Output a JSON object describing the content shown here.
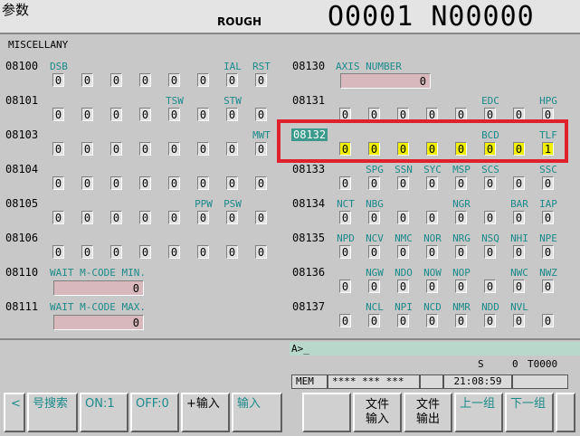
{
  "header": {
    "title_zh": "参数",
    "mode": "ROUGH",
    "program": "O0001 N00000"
  },
  "section": "MISCELLANY",
  "left_params": [
    {
      "num": "08100",
      "labels": [
        "DSB",
        "",
        "",
        "",
        "",
        "",
        "IAL",
        "RST"
      ],
      "values": [
        "0",
        "0",
        "0",
        "0",
        "0",
        "0",
        "0",
        "0"
      ]
    },
    {
      "num": "08101",
      "labels": [
        "",
        "",
        "",
        "",
        "TSW",
        "",
        "STW",
        ""
      ],
      "values": [
        "0",
        "0",
        "0",
        "0",
        "0",
        "0",
        "0",
        "0"
      ]
    },
    {
      "num": "08103",
      "labels": [
        "",
        "",
        "",
        "",
        "",
        "",
        "",
        "MWT"
      ],
      "values": [
        "0",
        "0",
        "0",
        "0",
        "0",
        "0",
        "0",
        "0"
      ]
    },
    {
      "num": "08104",
      "labels": [
        "",
        "",
        "",
        "",
        "",
        "",
        "",
        ""
      ],
      "values": [
        "0",
        "0",
        "0",
        "0",
        "0",
        "0",
        "0",
        "0"
      ]
    },
    {
      "num": "08105",
      "labels": [
        "",
        "",
        "",
        "",
        "",
        "PPW",
        "PSW",
        ""
      ],
      "values": [
        "0",
        "0",
        "0",
        "0",
        "0",
        "0",
        "0",
        "0"
      ]
    },
    {
      "num": "08106",
      "labels": [
        "",
        "",
        "",
        "",
        "",
        "",
        "",
        ""
      ],
      "values": [
        "0",
        "0",
        "0",
        "0",
        "0",
        "0",
        "0",
        "0"
      ]
    }
  ],
  "left_values": [
    {
      "num": "08110",
      "label": "WAIT M-CODE MIN.",
      "value": "0"
    },
    {
      "num": "08111",
      "label": "WAIT M-CODE MAX.",
      "value": "0"
    }
  ],
  "right_top": {
    "num": "08130",
    "label": "AXIS NUMBER",
    "value": "0"
  },
  "right_params": [
    {
      "num": "08131",
      "labels": [
        "",
        "",
        "",
        "",
        "",
        "EDC",
        "",
        "HPG"
      ],
      "values": [
        "0",
        "0",
        "0",
        "0",
        "0",
        "0",
        "0",
        "0"
      ]
    },
    {
      "num": "08132",
      "labels": [
        "",
        "",
        "",
        "",
        "",
        "BCD",
        "",
        "TLF"
      ],
      "values": [
        "0",
        "0",
        "0",
        "0",
        "0",
        "0",
        "0",
        "1"
      ]
    },
    {
      "num": "08133",
      "labels": [
        "",
        "SPG",
        "SSN",
        "SYC",
        "MSP",
        "SCS",
        "",
        "SSC"
      ],
      "values": [
        "0",
        "0",
        "0",
        "0",
        "0",
        "0",
        "0",
        "0"
      ]
    },
    {
      "num": "08134",
      "labels": [
        "NCT",
        "NBG",
        "",
        "",
        "NGR",
        "",
        "BAR",
        "IAP"
      ],
      "values": [
        "0",
        "0",
        "0",
        "0",
        "0",
        "0",
        "0",
        "0"
      ]
    },
    {
      "num": "08135",
      "labels": [
        "NPD",
        "NCV",
        "NMC",
        "NOR",
        "NRG",
        "NSQ",
        "NHI",
        "NPE"
      ],
      "values": [
        "0",
        "0",
        "0",
        "0",
        "0",
        "0",
        "0",
        "0"
      ]
    },
    {
      "num": "08136",
      "labels": [
        "",
        "NGW",
        "NDO",
        "NOW",
        "NOP",
        "",
        "NWC",
        "NWZ"
      ],
      "values": [
        "0",
        "0",
        "0",
        "0",
        "0",
        "0",
        "0",
        "0"
      ]
    },
    {
      "num": "08137",
      "labels": [
        "",
        "NCL",
        "NPI",
        "NCD",
        "NMR",
        "NDD",
        "NVL",
        ""
      ],
      "values": [
        "0",
        "0",
        "0",
        "0",
        "0",
        "0",
        "0",
        "0"
      ]
    }
  ],
  "cmdline": "A>_",
  "status": {
    "s_label": "S",
    "s_value": "0",
    "t_value": "T0000",
    "mode": "MEM",
    "stars": "**** *** ***",
    "time": "21:08:59"
  },
  "softkeys": {
    "left_arrow": "<",
    "search": "号搜索",
    "on": "ON:1",
    "off": "OFF:0",
    "plus_input": "+输入",
    "input": "输入",
    "blank": "",
    "file_input_1": "文件",
    "file_input_2": "输入",
    "file_output_1": "文件",
    "file_output_2": "输出",
    "prev_group": "上一组",
    "next_group": "下一组"
  }
}
